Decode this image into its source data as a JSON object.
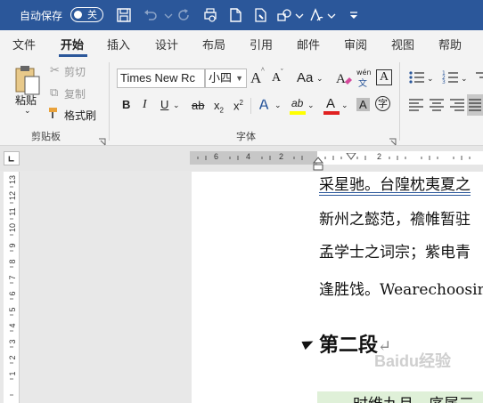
{
  "titlebar": {
    "autosave_label": "自动保存",
    "toggle_label": "关",
    "icons": [
      "save-icon",
      "undo-icon",
      "redo-icon",
      "print-preview-icon",
      "new-document-icon",
      "format-painter-quick-icon",
      "shapes-icon",
      "text-style-icon",
      "customize-quick-access-icon"
    ]
  },
  "tabs": [
    "文件",
    "开始",
    "插入",
    "设计",
    "布局",
    "引用",
    "邮件",
    "审阅",
    "视图",
    "帮助"
  ],
  "active_tab": "开始",
  "clipboard": {
    "paste_label": "粘贴",
    "cut_label": "剪切",
    "copy_label": "复制",
    "format_painter_label": "格式刷",
    "group_label": "剪贴板"
  },
  "font": {
    "font_name": "Times New Rc",
    "font_size": "小四",
    "group_label": "字体",
    "bold": "B",
    "italic": "I",
    "underline": "U",
    "strike": "ab",
    "subscript": "x",
    "superscript": "x",
    "grow": "A",
    "shrink": "A",
    "change_case": "Aa",
    "phonetic_top": "wén",
    "phonetic_bottom": "文",
    "char_border": "A",
    "text_effect": "A",
    "highlight": "ab",
    "font_color": "A",
    "char_shading": "A",
    "enclose": "字"
  },
  "colors": {
    "title_bg": "#2b579a",
    "highlight_yellow": "#ffff00",
    "font_red": "#e02020",
    "para_highlight": "#dff0d8"
  },
  "ruler": {
    "h_numbers": [
      "6",
      "4",
      "2",
      "2"
    ],
    "v_numbers": [
      "13",
      "12",
      "11",
      "10",
      "9",
      "8",
      "7",
      "6",
      "5",
      "4",
      "3",
      "2",
      "1"
    ]
  },
  "document": {
    "line1": "采星驰。台隍枕夷夏之",
    "line2": "新州之懿范，襜帷暂驻",
    "line3": "孟学士之词宗；紫电青",
    "line4": "逢胜饯。Wearechoosin",
    "heading": "第二段",
    "heading_mark": "↵",
    "para2": "时维九月，序属三"
  },
  "watermark": "Baidu经验"
}
